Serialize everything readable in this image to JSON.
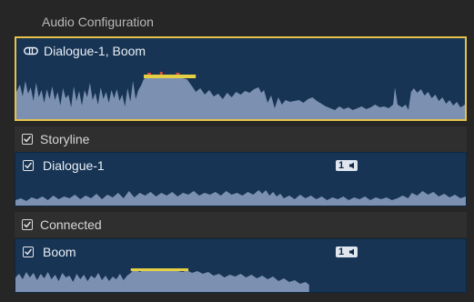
{
  "panel": {
    "title": "Audio Configuration"
  },
  "top_clip": {
    "label": "Dialogue-1, Boom",
    "icon": "linked-clip-icon"
  },
  "storyline": {
    "section_label": "Storyline",
    "checked": true,
    "clip": {
      "label": "Dialogue-1",
      "checked": true,
      "channel_badge": "1"
    }
  },
  "connected": {
    "section_label": "Connected",
    "checked": true,
    "clip": {
      "label": "Boom",
      "checked": true,
      "channel_badge": "1"
    }
  },
  "colors": {
    "clip_bg": "#173454",
    "selected_border": "#e6c24a",
    "waveform": "#7c91b2",
    "peak_yellow": "#e4cf45",
    "peak_red": "#e04a3a"
  }
}
